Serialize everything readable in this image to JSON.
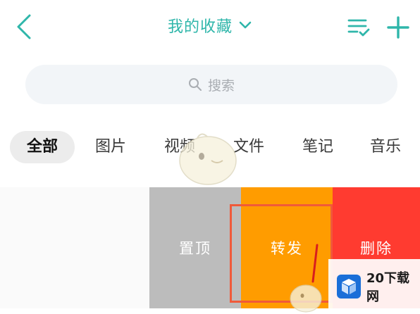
{
  "header": {
    "title": "我的收藏",
    "back_icon": "chevron-left-icon",
    "title_dropdown_icon": "chevron-down-icon",
    "list_icon": "list-check-icon",
    "add_icon": "plus-icon",
    "accent_color": "#2fb6aa"
  },
  "search": {
    "placeholder": "搜索",
    "icon": "search-icon"
  },
  "tabs": [
    {
      "label": "全部",
      "active": true
    },
    {
      "label": "图片",
      "active": false
    },
    {
      "label": "视频",
      "active": false
    },
    {
      "label": "文件",
      "active": false
    },
    {
      "label": "笔记",
      "active": false
    },
    {
      "label": "音乐",
      "active": false
    }
  ],
  "item_actions": {
    "pin": {
      "label": "置顶",
      "color": "#bcbcbc"
    },
    "forward": {
      "label": "转发",
      "color": "#ff9c00"
    },
    "delete": {
      "label": "删除",
      "color": "#ff3b30"
    }
  },
  "watermark": {
    "text": "20下载网"
  }
}
